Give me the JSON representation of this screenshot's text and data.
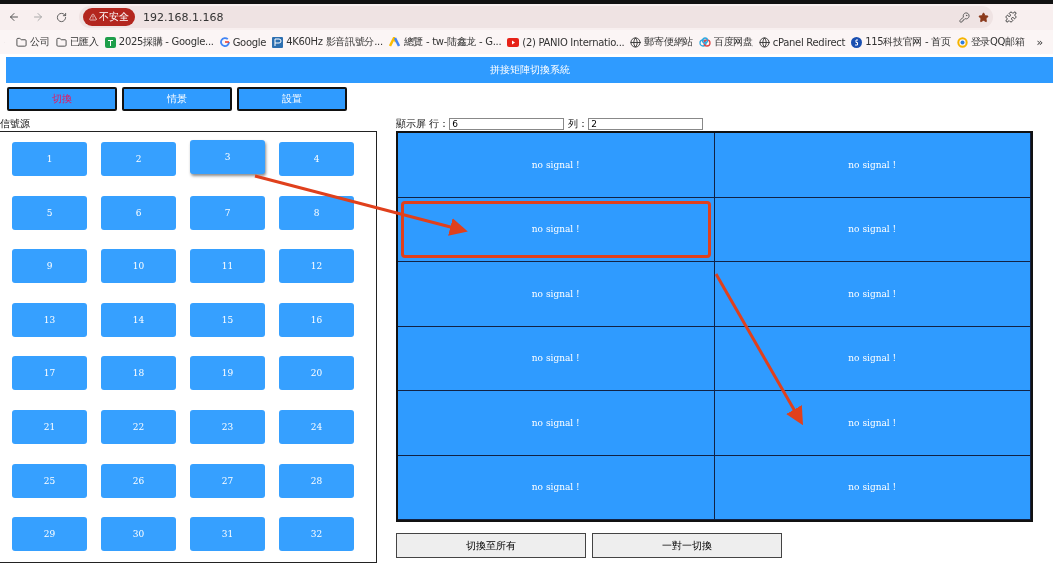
{
  "browser": {
    "security_badge": "不安全",
    "address": "192.168.1.168",
    "bookmarks": [
      {
        "kind": "folder",
        "label": "公司"
      },
      {
        "kind": "folder",
        "label": "已匯入"
      },
      {
        "kind": "sheet",
        "label": "2025採購 - Google..."
      },
      {
        "kind": "google",
        "label": "Google"
      },
      {
        "kind": "panel",
        "label": "4K60Hz 影音訊號分..."
      },
      {
        "kind": "ads",
        "label": "總覽 - tw-陆鑫龙 - G..."
      },
      {
        "kind": "video",
        "label": "(2) PANIO Internatio..."
      },
      {
        "kind": "globe",
        "label": "郵寄便網站"
      },
      {
        "kind": "cloud",
        "label": "百度网盘"
      },
      {
        "kind": "globe",
        "label": "cPanel Redirect"
      },
      {
        "kind": "circle",
        "label": "115科技官网 - 首页"
      },
      {
        "kind": "ring",
        "label": "登录QQ邮箱"
      }
    ],
    "more": "»"
  },
  "header": {
    "title": "拼接矩陣切換系統"
  },
  "tabs": [
    {
      "label": "切換",
      "selected": true
    },
    {
      "label": "情景",
      "selected": false
    },
    {
      "label": "設置",
      "selected": false
    }
  ],
  "sources": {
    "label": "信號源",
    "items": [
      {
        "label": "1",
        "selected": false
      },
      {
        "label": "2",
        "selected": false
      },
      {
        "label": "3",
        "selected": true
      },
      {
        "label": "4",
        "selected": false
      },
      {
        "label": "5",
        "selected": false
      },
      {
        "label": "6",
        "selected": false
      },
      {
        "label": "7",
        "selected": false
      },
      {
        "label": "8",
        "selected": false
      },
      {
        "label": "9",
        "selected": false
      },
      {
        "label": "10",
        "selected": false
      },
      {
        "label": "11",
        "selected": false
      },
      {
        "label": "12",
        "selected": false
      },
      {
        "label": "13",
        "selected": false
      },
      {
        "label": "14",
        "selected": false
      },
      {
        "label": "15",
        "selected": false
      },
      {
        "label": "16",
        "selected": false
      },
      {
        "label": "17",
        "selected": false
      },
      {
        "label": "18",
        "selected": false
      },
      {
        "label": "19",
        "selected": false
      },
      {
        "label": "20",
        "selected": false
      },
      {
        "label": "21",
        "selected": false
      },
      {
        "label": "22",
        "selected": false
      },
      {
        "label": "23",
        "selected": false
      },
      {
        "label": "24",
        "selected": false
      },
      {
        "label": "25",
        "selected": false
      },
      {
        "label": "26",
        "selected": false
      },
      {
        "label": "27",
        "selected": false
      },
      {
        "label": "28",
        "selected": false
      },
      {
        "label": "29",
        "selected": false
      },
      {
        "label": "30",
        "selected": false
      },
      {
        "label": "31",
        "selected": false
      },
      {
        "label": "32",
        "selected": false
      }
    ]
  },
  "display": {
    "rows_label": "顯示屏 行：",
    "rows_value": "6",
    "cols_label": "列：",
    "cols_value": "2",
    "cells": [
      {
        "text": "no signal !",
        "highlighted": false
      },
      {
        "text": "no signal !",
        "highlighted": false
      },
      {
        "text": "no signal !",
        "highlighted": true
      },
      {
        "text": "no signal !",
        "highlighted": false
      },
      {
        "text": "no signal !",
        "highlighted": false
      },
      {
        "text": "no signal !",
        "highlighted": false
      },
      {
        "text": "no signal !",
        "highlighted": false
      },
      {
        "text": "no signal !",
        "highlighted": false
      },
      {
        "text": "no signal !",
        "highlighted": false
      },
      {
        "text": "no signal !",
        "highlighted": false
      },
      {
        "text": "no signal !",
        "highlighted": false
      },
      {
        "text": "no signal !",
        "highlighted": false
      }
    ]
  },
  "actions": [
    "切換至所有",
    "一對一切換"
  ]
}
